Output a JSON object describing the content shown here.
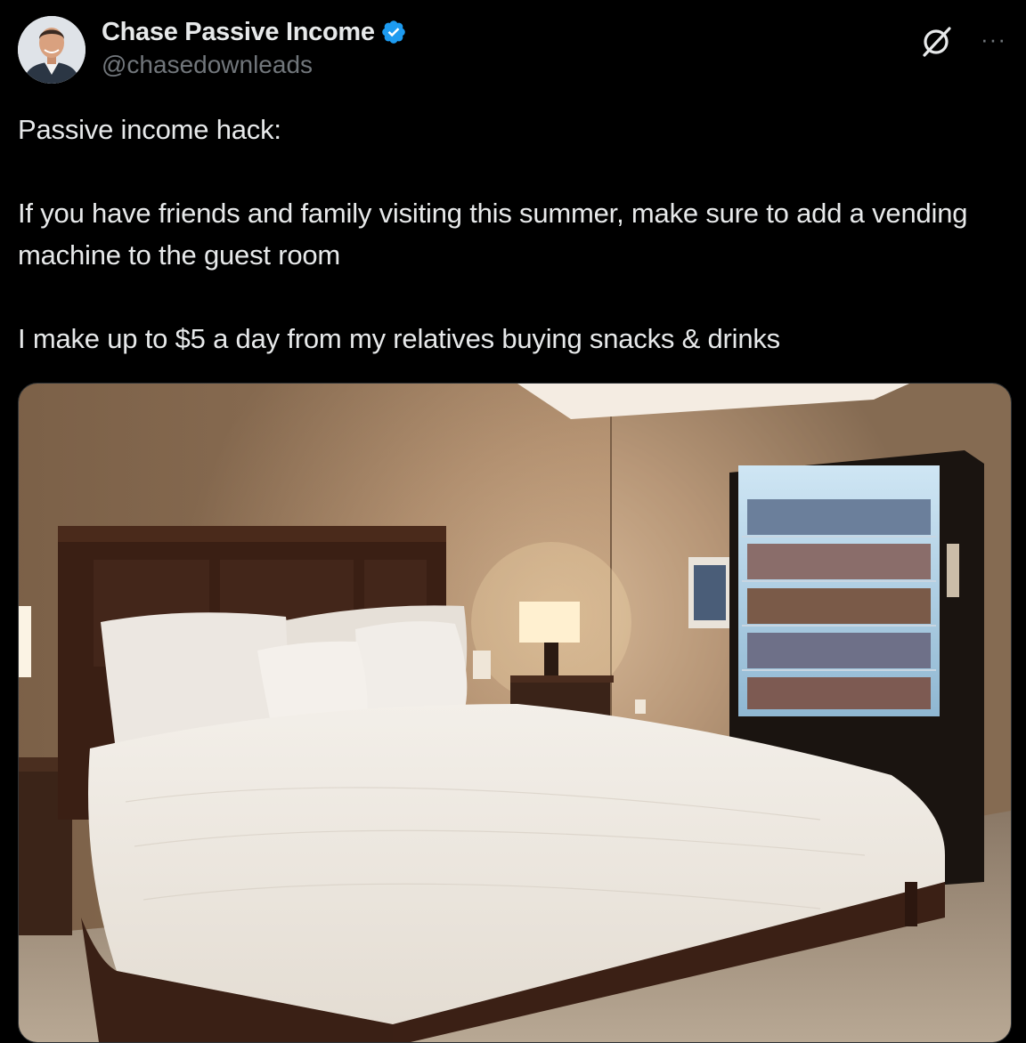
{
  "author": {
    "display_name": "Chase Passive Income",
    "handle": "@chasedownleads",
    "verified": true,
    "avatar_icon": "avatar-photo"
  },
  "header_icons": [
    "grok-icon",
    "more-icon"
  ],
  "more_glyph": "···",
  "tweet": {
    "paragraphs": [
      "Passive income hack:",
      "If you have friends and family visiting this summer, make sure to add a vending machine to the guest room",
      "I make up to $5 a day from my relatives buying snacks & drinks"
    ]
  },
  "media": {
    "kind": "photo",
    "subject": "guest-room-with-vending-machine"
  },
  "colors": {
    "background": "#000000",
    "text": "#e7e9ea",
    "secondary": "#71767b",
    "verified_blue": "#1d9bf0"
  }
}
